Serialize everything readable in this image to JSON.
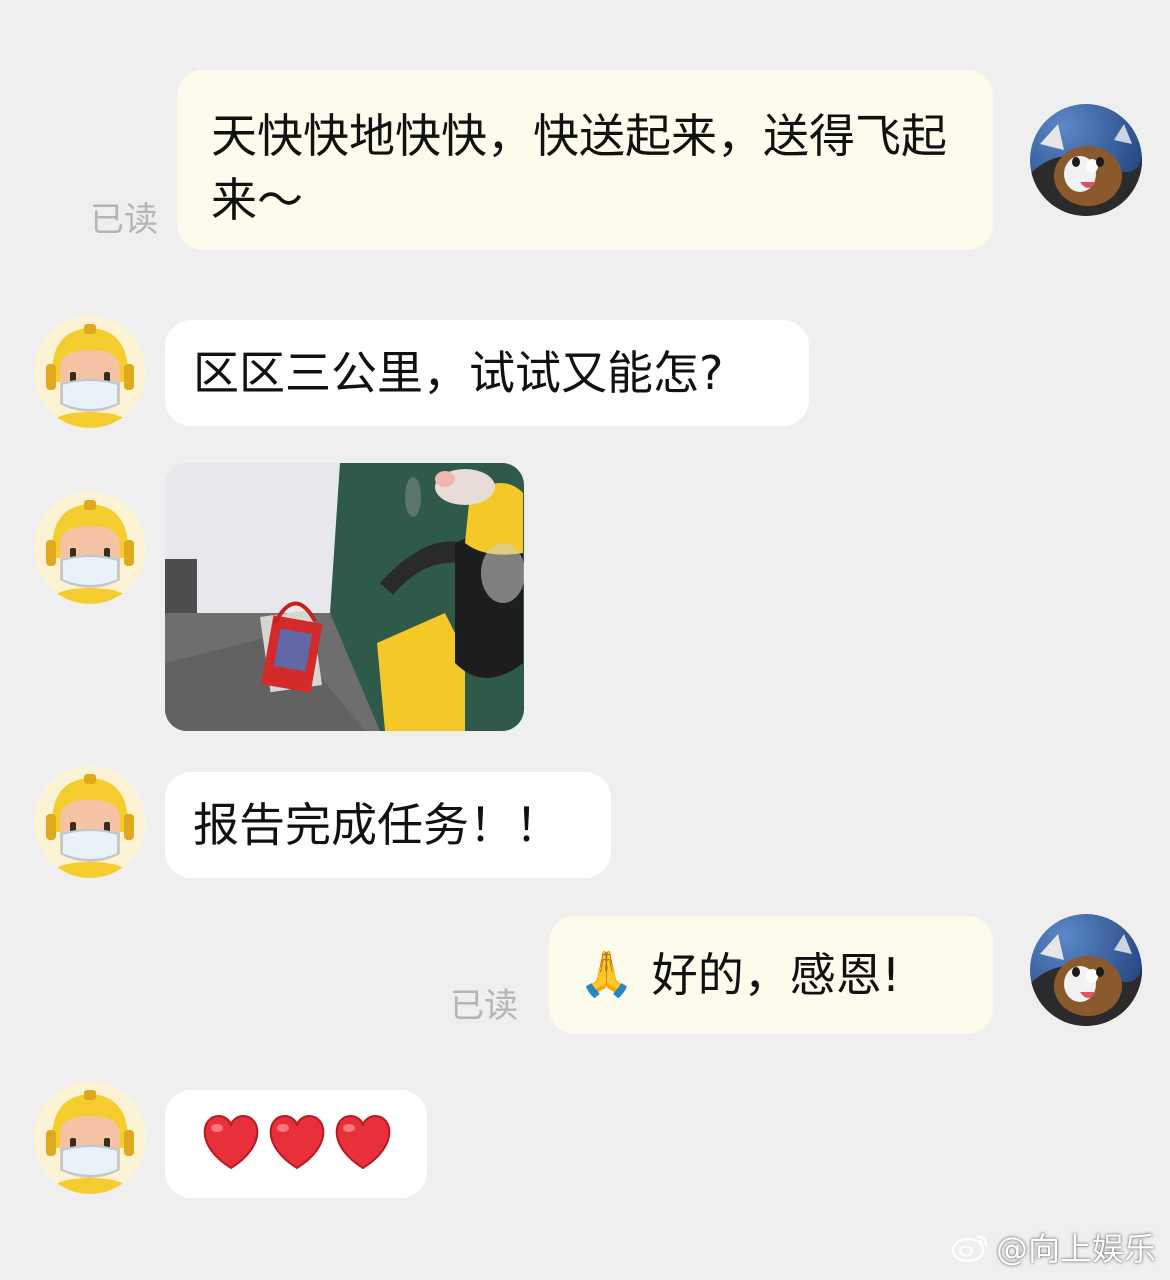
{
  "messages": [
    {
      "side": "me",
      "text": "天快快地快快，快送起来，送得飞起来～",
      "status": "已读"
    },
    {
      "side": "other",
      "text": "区区三公里，试试又能怎?"
    },
    {
      "side": "other",
      "type": "image",
      "content": "photo of delivery rider in yellow helmet next to red gift bag"
    },
    {
      "side": "other",
      "text": "报告完成任务！！"
    },
    {
      "side": "me",
      "emoji": "🙏",
      "text": "好的，感恩!",
      "status": "已读"
    },
    {
      "side": "other",
      "text": "❤❤❤"
    }
  ],
  "watermark": {
    "text": "@向上娱乐",
    "icon": "weibo-icon"
  },
  "colors": {
    "background": "#efefef",
    "my_bubble": "#fdfbeb",
    "their_bubble": "#ffffff",
    "read_status": "#b5b5b5",
    "helmet_yellow": "#f6cd2e",
    "heart_red": "#e8303a"
  }
}
